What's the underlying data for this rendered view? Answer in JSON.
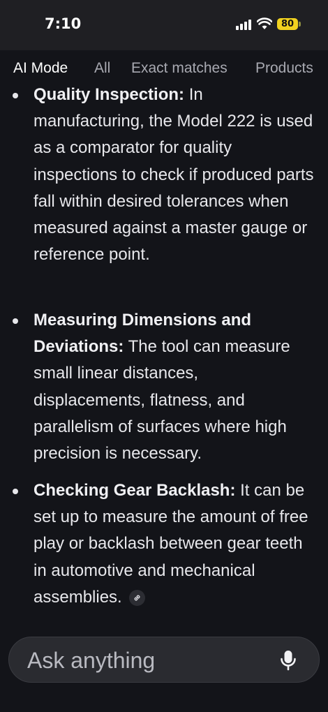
{
  "status_bar": {
    "time": "7:10",
    "battery": "80"
  },
  "tabs": [
    {
      "label": "AI Mode",
      "active": true
    },
    {
      "label": "All"
    },
    {
      "label": "Exact matches"
    },
    {
      "label": "Products"
    }
  ],
  "content": {
    "bullets": [
      {
        "title": "Quality Inspection:",
        "text": " In manufacturing, the Model 222 is used as a comparator for quality inspections to check if produced parts fall within desired tolerances when measured against a master gauge or reference point."
      },
      {
        "title": "Measuring Dimensions and Deviations:",
        "text": " The tool can measure small linear distances, displacements, flatness, and parallelism of surfaces where high precision is necessary."
      },
      {
        "title": "Checking Gear Backlash:",
        "text": " It can be set up to measure the amount of free play or backlash between gear teeth in automotive and mechanical assemblies."
      }
    ]
  },
  "search": {
    "placeholder": "Ask anything",
    "value": ""
  },
  "colors": {
    "background": "#131419",
    "status_bar": "#1f1f23",
    "battery": "#f1d21f",
    "input_bg": "#2a2b30"
  },
  "icons": [
    "signal-icon",
    "wifi-icon",
    "battery-icon",
    "link-icon",
    "microphone-icon"
  ]
}
